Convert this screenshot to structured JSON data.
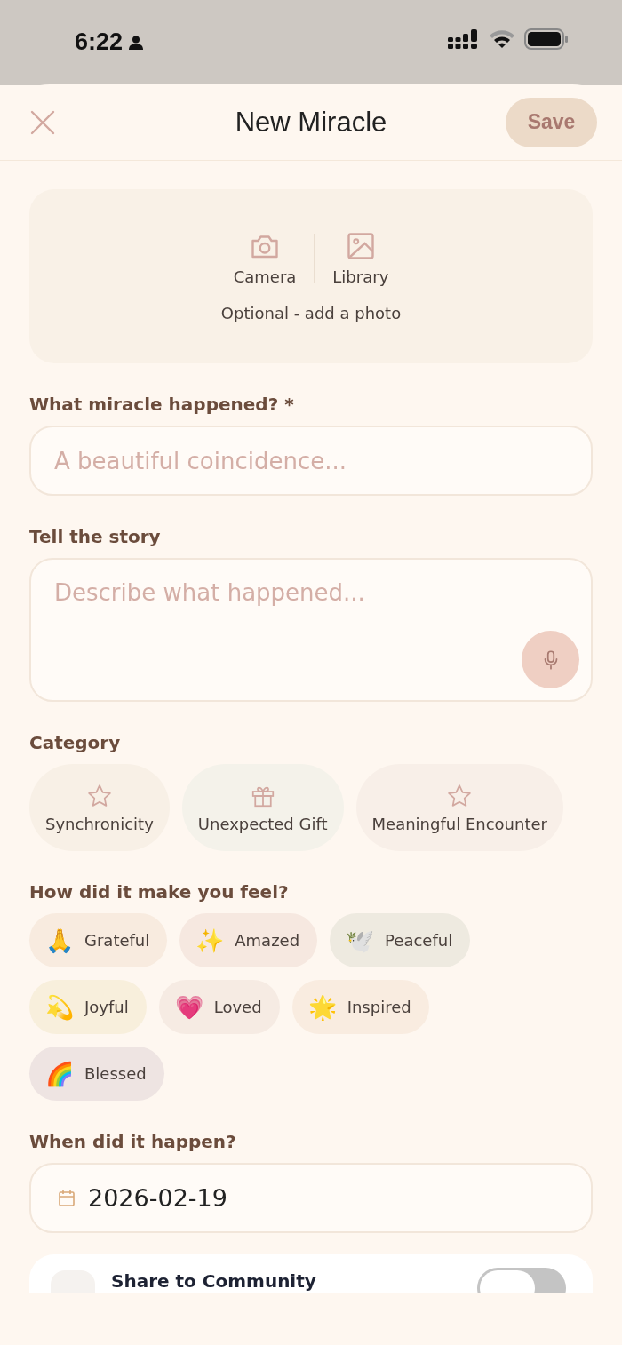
{
  "status_bar": {
    "time": "6:22"
  },
  "header": {
    "title": "New Miracle",
    "save": {
      "label": "Save",
      "disabled": true
    }
  },
  "photo": {
    "options": [
      {
        "label": "Camera",
        "kind": "camera"
      },
      {
        "label": "Library",
        "kind": "library"
      }
    ],
    "hint": "Optional - add a photo"
  },
  "title_field": {
    "label": "What miracle happened? *",
    "placeholder": "A beautiful coincidence..."
  },
  "story_field": {
    "label": "Tell the story",
    "placeholder": "Describe what happened..."
  },
  "category": {
    "label": "Category",
    "options": [
      {
        "label": "Synchronicity",
        "kind": "star",
        "selected": false,
        "color": "#f8f0e6"
      },
      {
        "label": "Unexpected Gift",
        "kind": "gift",
        "selected": false,
        "color": "#f4f2ea"
      },
      {
        "label": "Meaningful Encounter",
        "kind": "star",
        "selected": false,
        "color": "#f8efe8"
      }
    ]
  },
  "feelings": {
    "label": "How did it make you feel?",
    "options": [
      {
        "emoji": "🙏",
        "label": "Grateful",
        "selected": false,
        "color": "#f8ebdf"
      },
      {
        "emoji": "✨",
        "label": "Amazed",
        "selected": false,
        "color": "#f6e8e0"
      },
      {
        "emoji": "🕊️",
        "label": "Peaceful",
        "selected": false,
        "color": "#eeeae0"
      },
      {
        "emoji": "💫",
        "label": "Joyful",
        "selected": false,
        "color": "#f8efdc"
      },
      {
        "emoji": "💗",
        "label": "Loved",
        "selected": false,
        "color": "#f6ebe3"
      },
      {
        "emoji": "🌟",
        "label": "Inspired",
        "selected": false,
        "color": "#f9ece0"
      },
      {
        "emoji": "🌈",
        "label": "Blessed",
        "selected": false,
        "color": "#eee4e2"
      }
    ]
  },
  "date_field": {
    "label": "When did it happen?",
    "value": "2026-02-19"
  },
  "share": {
    "label": "Share to Community",
    "on": false
  }
}
